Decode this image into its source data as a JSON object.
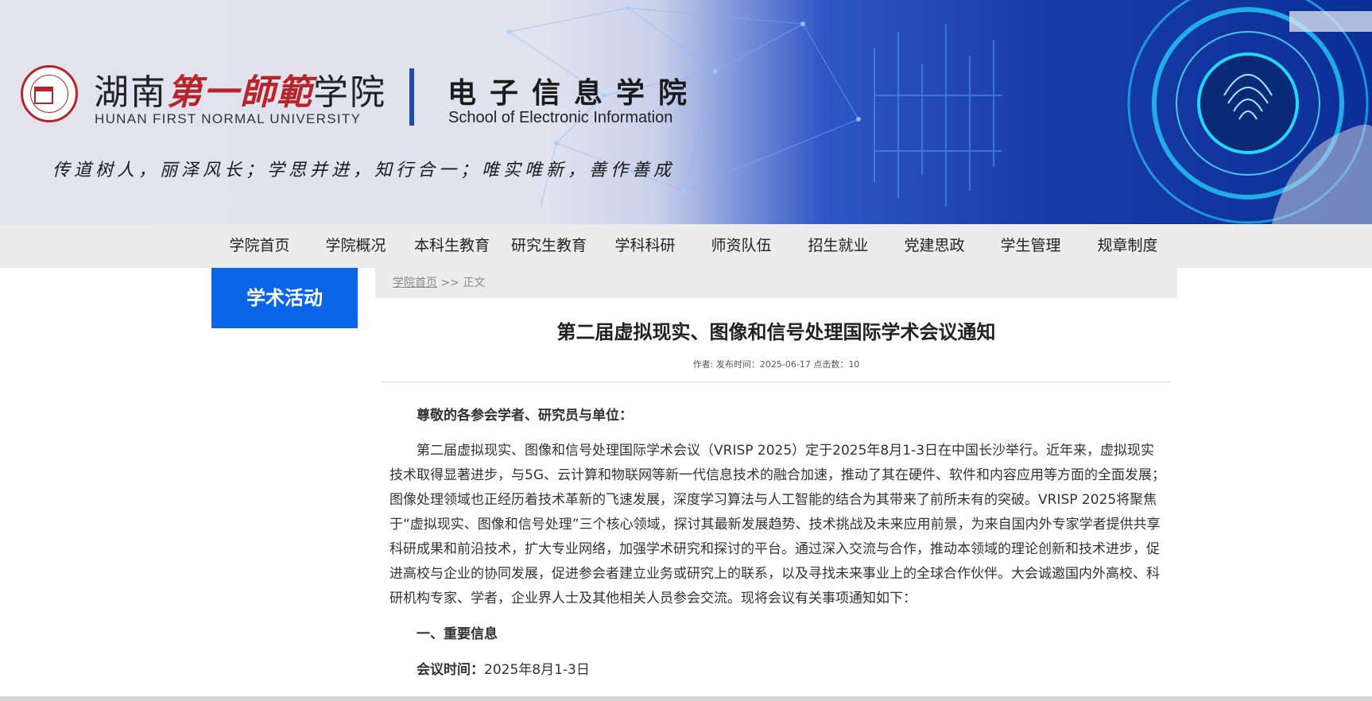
{
  "header": {
    "university_cn_1": "湖南",
    "university_cn_calli": "第一師範",
    "university_cn_2": "学院",
    "university_en": "HUNAN FIRST NORMAL UNIVERSITY",
    "school_cn": "电子信息学院",
    "school_en": "School of Electronic Information",
    "motto": "传道树人，丽泽风长；学思并进，知行合一；唯实唯新，善作善成"
  },
  "nav": {
    "items": [
      "学院首页",
      "学院概况",
      "本科生教育",
      "研究生教育",
      "学科科研",
      "师资队伍",
      "招生就业",
      "党建思政",
      "学生管理",
      "规章制度"
    ]
  },
  "sidebar": {
    "title": "学术活动"
  },
  "breadcrumb": {
    "home": "学院首页",
    "sep": " >> ",
    "current": "正文"
  },
  "article": {
    "title": "第二届虚拟现实、图像和信号处理国际学术会议通知",
    "meta": "作者:  发布时间：2025-06-17 点击数：10",
    "greeting": "尊敬的各参会学者、研究员与单位：",
    "paragraph": "第二届虚拟现实、图像和信号处理国际学术会议（VRISP 2025）定于2025年8月1-3日在中国长沙举行。近年来，虚拟现实技术取得显著进步，与5G、云计算和物联网等新一代信息技术的融合加速，推动了其在硬件、软件和内容应用等方面的全面发展；图像处理领域也正经历着技术革新的飞速发展，深度学习算法与人工智能的结合为其带来了前所未有的突破。VRISP 2025将聚焦于“虚拟现实、图像和信号处理”三个核心领域，探讨其最新发展趋势、技术挑战及未来应用前景，为来自国内外专家学者提供共享科研成果和前沿技术，扩大专业网络，加强学术研究和探讨的平台。通过深入交流与合作，推动本领域的理论创新和技术进步，促进高校与企业的协同发展，促进参会者建立业务或研究上的联系，以及寻找未来事业上的全球合作伙伴。大会诚邀国内外高校、科研机构专家、学者，企业界人士及其他相关人员参会交流。现将会议有关事项通知如下：",
    "section1": "一、重要信息",
    "date_label": "会议时间：",
    "date_value": "2025年8月1-3日"
  },
  "colors": {
    "nav_bg": "#ececec",
    "sidebar_accent": "#0a66e6",
    "logo_red": "#b5252a",
    "divider_blue": "#1c4ea7"
  }
}
